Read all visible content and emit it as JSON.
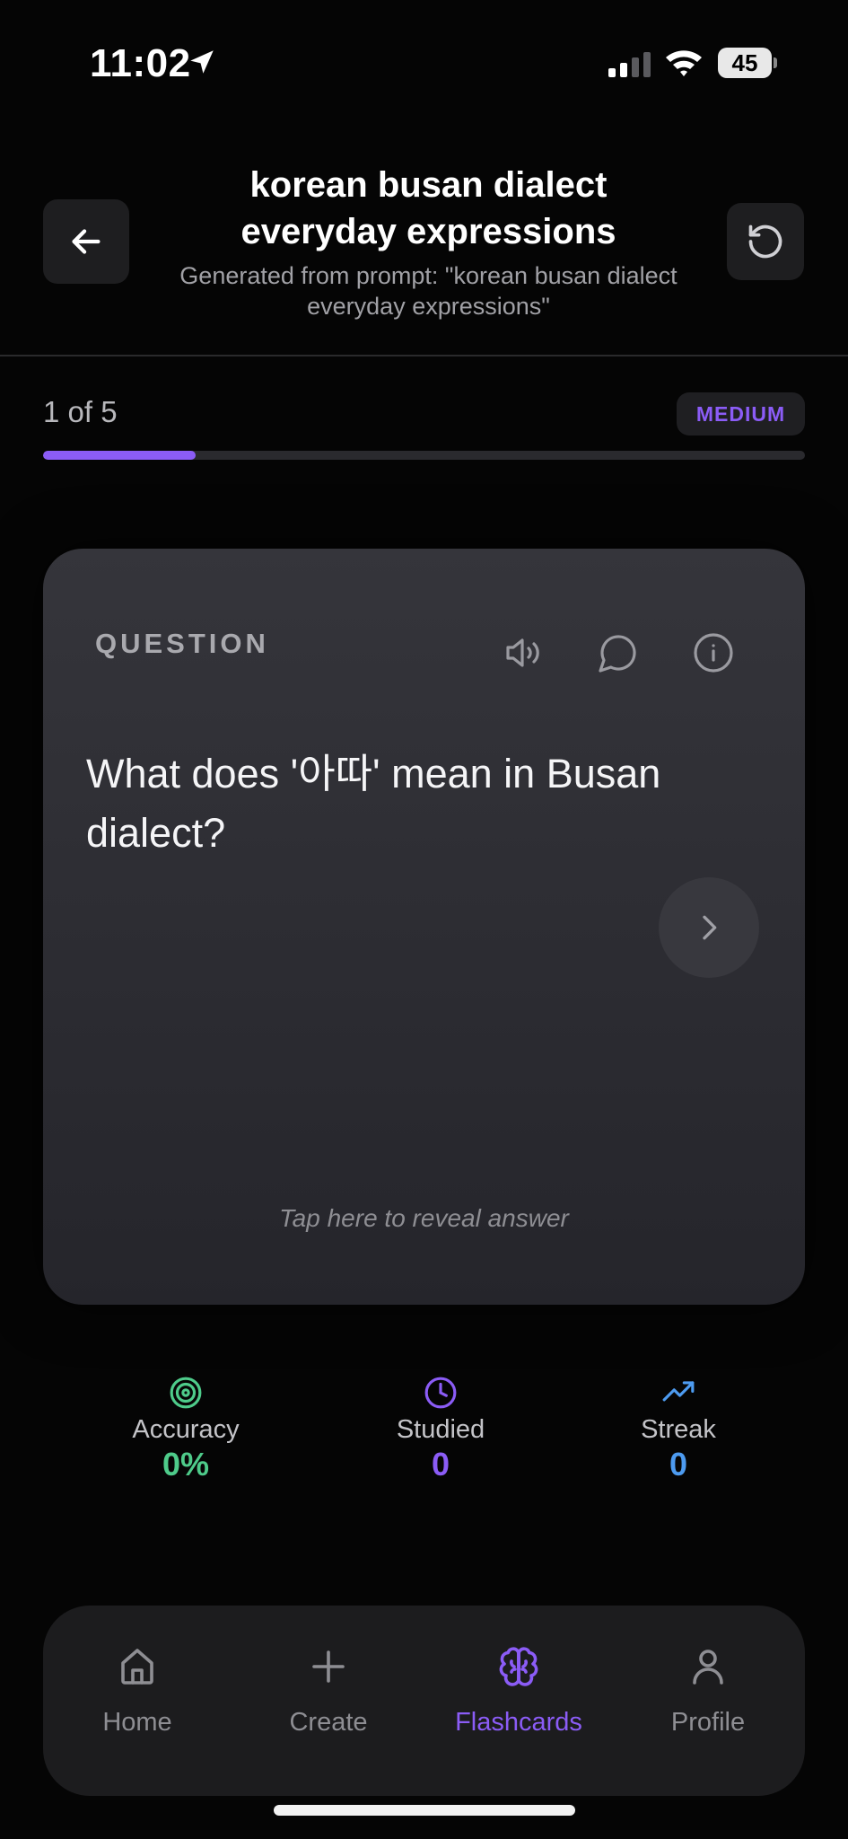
{
  "status_bar": {
    "time": "11:02",
    "battery": "45"
  },
  "header": {
    "title": "korean busan dialect everyday expressions",
    "subtitle": "Generated from prompt: \"korean busan dialect everyday expressions\""
  },
  "progress": {
    "label": "1 of 5",
    "difficulty": "MEDIUM",
    "fraction": 0.2
  },
  "card": {
    "label": "QUESTION",
    "question": "What does '아따' mean in Busan dialect?",
    "reveal_hint": "Tap here to reveal answer"
  },
  "stats": {
    "accuracy": {
      "label": "Accuracy",
      "value": "0%"
    },
    "studied": {
      "label": "Studied",
      "value": "0"
    },
    "streak": {
      "label": "Streak",
      "value": "0"
    }
  },
  "nav": {
    "home": "Home",
    "create": "Create",
    "flashcards": "Flashcards",
    "profile": "Profile",
    "active": "flashcards"
  },
  "colors": {
    "accent": "#8b5cf6",
    "accuracy": "#4ecb8a",
    "studied": "#8b5cf6",
    "streak": "#4d9bf0"
  }
}
